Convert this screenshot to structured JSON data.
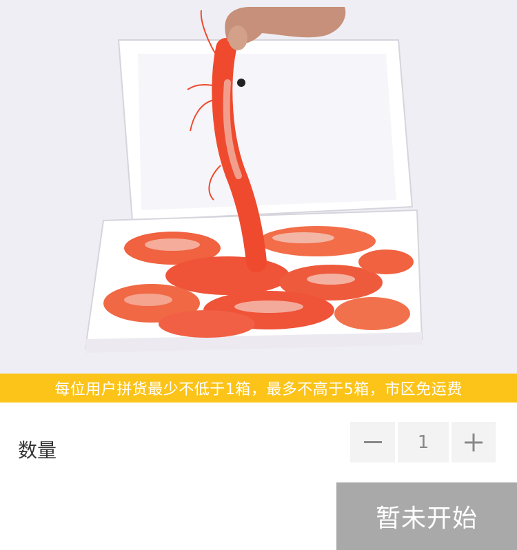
{
  "product": {
    "image_alt": "frozen red shrimp in an open white box",
    "notice": "每位用户拼货最少不低于1箱，最多不高于5箱，市区免运费"
  },
  "quantity": {
    "label": "数量",
    "value": "1",
    "minus_icon": "minus-icon",
    "plus_icon": "plus-icon"
  },
  "actions": {
    "status_button": "暂未开始"
  },
  "colors": {
    "notice_bg": "#fcc318",
    "button_disabled": "#a9a9a9",
    "shrimp": "#ef4a2e"
  }
}
